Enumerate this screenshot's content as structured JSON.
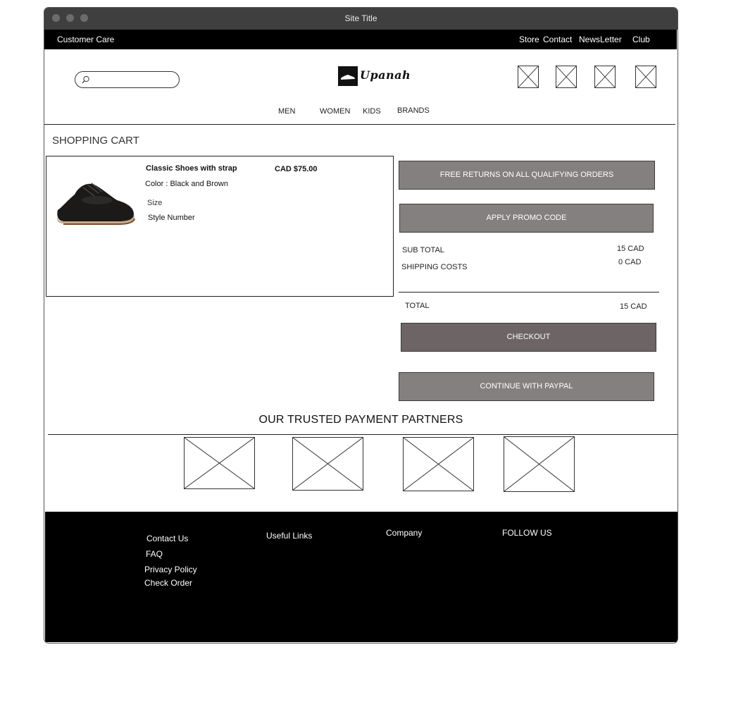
{
  "window": {
    "title": "Site Title"
  },
  "topbar": {
    "customer_care": "Customer Care",
    "links": [
      "Store",
      "Contact",
      "NewsLetter",
      "Club"
    ]
  },
  "header": {
    "search": {
      "placeholder": "",
      "icon": "search-icon"
    },
    "logo_text": "Upanah",
    "icon_placeholders": 4
  },
  "nav": {
    "items": [
      "MEN",
      "WOMEN",
      "KIDS",
      "BRANDS"
    ]
  },
  "cart": {
    "heading": "SHOPPING CART",
    "item": {
      "name": "Classic Shoes with strap",
      "price": "CAD $75.00",
      "color": "Color : Black and Brown",
      "size_label": "Size",
      "style_label": "Style Number"
    }
  },
  "summary": {
    "free_returns": "FREE RETURNS ON ALL QUALIFYING ORDERS",
    "promo": "APPLY PROMO CODE",
    "subtotal_label": "SUB TOTAL",
    "subtotal_value": "15 CAD",
    "shipping_label": "SHIPPING COSTS",
    "shipping_value": "0 CAD",
    "total_label": "TOTAL",
    "total_value": "15 CAD",
    "checkout": "CHECKOUT",
    "paypal": "CONTINUE WITH PAYPAL"
  },
  "partners": {
    "title": "OUR TRUSTED PAYMENT PARTNERS",
    "count": 4
  },
  "footer": {
    "contact": "Contact Us",
    "faq": "FAQ",
    "privacy": "Privacy Policy",
    "check_order": "Check Order",
    "useful_links": "Useful Links",
    "company": "Company",
    "follow": "FOLLOW US"
  },
  "colors": {
    "topbar": "#000000",
    "button": "#858080",
    "checkout": "#6d6565",
    "titlebar": "#3f3f3f"
  }
}
